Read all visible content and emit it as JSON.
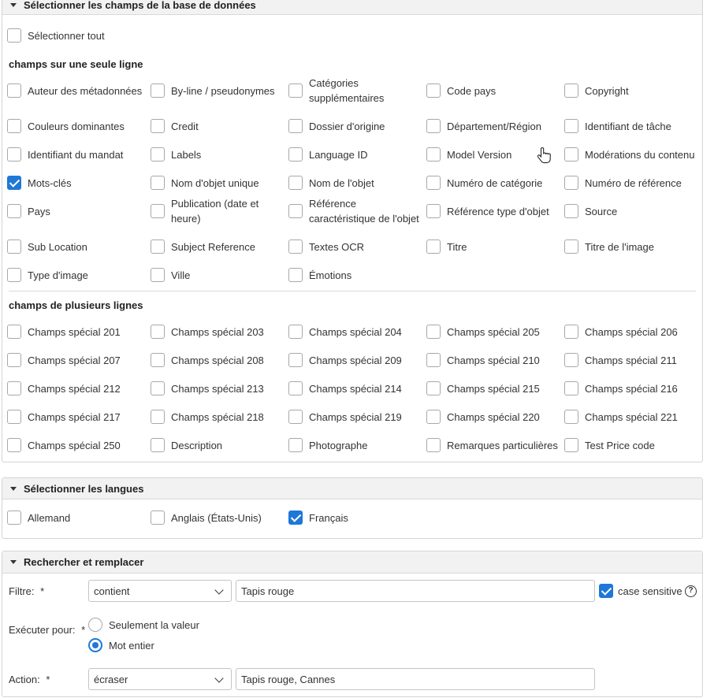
{
  "db_fields_panel": {
    "title": "Sélectionner les champs de la base de données",
    "select_all": {
      "label": "Sélectionner tout",
      "checked": false
    },
    "single_line": {
      "title": "champs sur une seule ligne",
      "rows": [
        [
          {
            "label": "Auteur des métadonnées",
            "checked": false
          },
          {
            "label": "By-line / pseudonymes",
            "checked": false
          },
          {
            "label": "Catégories supplémentaires",
            "checked": false
          },
          {
            "label": "Code pays",
            "checked": false
          },
          {
            "label": "Copyright",
            "checked": false
          }
        ],
        [
          {
            "label": "Couleurs dominantes",
            "checked": false
          },
          {
            "label": "Credit",
            "checked": false
          },
          {
            "label": "Dossier d'origine",
            "checked": false
          },
          {
            "label": "Département/Région",
            "checked": false
          },
          {
            "label": "Identifiant de tâche",
            "checked": false
          }
        ],
        [
          {
            "label": "Identifiant du mandat",
            "checked": false
          },
          {
            "label": "Labels",
            "checked": false
          },
          {
            "label": "Language ID",
            "checked": false
          },
          {
            "label": "Model Version",
            "checked": false
          },
          {
            "label": "Modérations du contenu",
            "checked": false
          }
        ],
        [
          {
            "label": "Mots-clés",
            "checked": true
          },
          {
            "label": "Nom d'objet unique",
            "checked": false
          },
          {
            "label": "Nom de l'objet",
            "checked": false
          },
          {
            "label": "Numéro de catégorie",
            "checked": false
          },
          {
            "label": "Numéro de référence",
            "checked": false
          }
        ],
        [
          {
            "label": "Pays",
            "checked": false
          },
          {
            "label": "Publication (date et heure)",
            "checked": false
          },
          {
            "label": "Référence caractéristique de l'objet",
            "checked": false
          },
          {
            "label": "Référence type d'objet",
            "checked": false
          },
          {
            "label": "Source",
            "checked": false
          }
        ],
        [
          {
            "label": "Sub Location",
            "checked": false
          },
          {
            "label": "Subject Reference",
            "checked": false
          },
          {
            "label": "Textes OCR",
            "checked": false
          },
          {
            "label": "Titre",
            "checked": false
          },
          {
            "label": "Titre de l'image",
            "checked": false
          }
        ],
        [
          {
            "label": "Type d'image",
            "checked": false
          },
          {
            "label": "Ville",
            "checked": false
          },
          {
            "label": "Émotions",
            "checked": false
          }
        ]
      ]
    },
    "multi_line": {
      "title": "champs de plusieurs lignes",
      "rows": [
        [
          {
            "label": "Champs spécial 201",
            "checked": false
          },
          {
            "label": "Champs spécial 203",
            "checked": false
          },
          {
            "label": "Champs spécial 204",
            "checked": false
          },
          {
            "label": "Champs spécial 205",
            "checked": false
          },
          {
            "label": "Champs spécial 206",
            "checked": false
          }
        ],
        [
          {
            "label": "Champs spécial 207",
            "checked": false
          },
          {
            "label": "Champs spécial 208",
            "checked": false
          },
          {
            "label": "Champs spécial 209",
            "checked": false
          },
          {
            "label": "Champs spécial 210",
            "checked": false
          },
          {
            "label": "Champs spécial 211",
            "checked": false
          }
        ],
        [
          {
            "label": "Champs spécial 212",
            "checked": false
          },
          {
            "label": "Champs spécial 213",
            "checked": false
          },
          {
            "label": "Champs spécial 214",
            "checked": false
          },
          {
            "label": "Champs spécial 215",
            "checked": false
          },
          {
            "label": "Champs spécial 216",
            "checked": false
          }
        ],
        [
          {
            "label": "Champs spécial 217",
            "checked": false
          },
          {
            "label": "Champs spécial 218",
            "checked": false
          },
          {
            "label": "Champs spécial 219",
            "checked": false
          },
          {
            "label": "Champs spécial 220",
            "checked": false
          },
          {
            "label": "Champs spécial 221",
            "checked": false
          }
        ],
        [
          {
            "label": "Champs spécial 250",
            "checked": false
          },
          {
            "label": "Description",
            "checked": false
          },
          {
            "label": "Photographe",
            "checked": false
          },
          {
            "label": "Remarques particulières",
            "checked": false
          },
          {
            "label": "Test Price code",
            "checked": false
          }
        ]
      ]
    }
  },
  "languages_panel": {
    "title": "Sélectionner les langues",
    "items": [
      {
        "label": "Allemand",
        "checked": false
      },
      {
        "label": "Anglais (États-Unis)",
        "checked": false
      },
      {
        "label": "Français",
        "checked": true
      }
    ]
  },
  "search_replace_panel": {
    "title": "Rechercher et remplacer",
    "filter_label": "Filtre:",
    "required_mark": "*",
    "filter_select_value": "contient",
    "filter_text_value": "Tapis rouge",
    "case_sensitive_label": "case sensitive",
    "case_sensitive_checked": true,
    "help_glyph": "?",
    "execute_label": "Exécuter pour:",
    "radio_options": [
      {
        "label": "Seulement la valeur",
        "selected": false
      },
      {
        "label": "Mot entier",
        "selected": true
      }
    ],
    "action_label": "Action:",
    "action_select_value": "écraser",
    "action_text_value": "Tapis rouge, Cannes"
  },
  "colors": {
    "accent": "#1e78d7",
    "header_bg": "#f2f2f2",
    "border": "#d4d4d4"
  },
  "icons": [
    "caret-down-icon",
    "chevron-down-icon",
    "help-circle-icon",
    "hand-pointer-cursor-icon"
  ]
}
